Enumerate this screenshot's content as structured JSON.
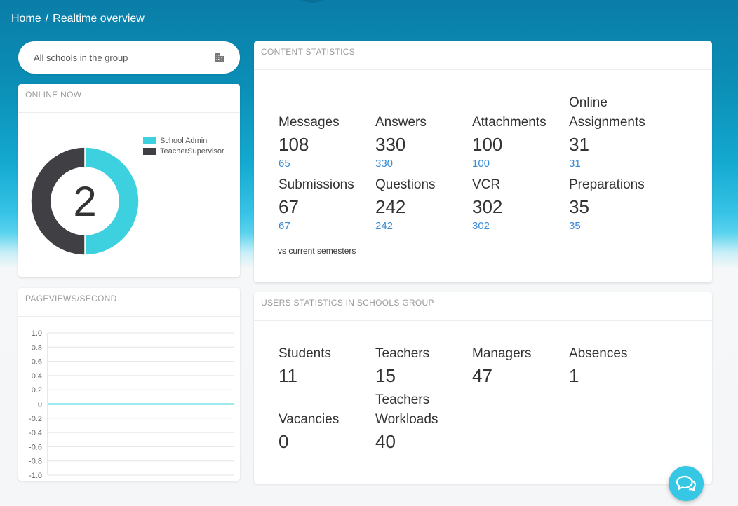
{
  "breadcrumb": {
    "home": "Home",
    "separator": "/",
    "current": "Realtime overview"
  },
  "school_selector": {
    "value": "All schools in the group",
    "icon": "building-icon"
  },
  "online_now": {
    "title": "ONLINE NOW",
    "total": "2",
    "legend": [
      {
        "label": "School Admin",
        "color": "#3dd0de"
      },
      {
        "label": "TeacherSupervisor",
        "color": "#3f3f44"
      }
    ],
    "slices": [
      {
        "label": "School Admin",
        "value": 1,
        "color": "#3dd0de"
      },
      {
        "label": "TeacherSupervisor",
        "value": 1,
        "color": "#3f3f44"
      }
    ]
  },
  "pageviews": {
    "title": "PAGEVIEWS/SECOND",
    "chart_data": {
      "type": "line",
      "title": "",
      "ylim": [
        -1.0,
        1.0
      ],
      "y_ticks": [
        "1.0",
        "0.8",
        "0.6",
        "0.4",
        "0.2",
        "0",
        "-0.2",
        "-0.4",
        "-0.6",
        "-0.8",
        "-1.0"
      ],
      "series": [
        {
          "values": [
            0,
            0
          ]
        }
      ],
      "line_color": "#3dd0de",
      "grid": true
    }
  },
  "content_stats": {
    "title": "CONTENT STATISTICS",
    "items": [
      {
        "label": "Messages",
        "value": "108",
        "sub": "65"
      },
      {
        "label": "Answers",
        "value": "330",
        "sub": "330"
      },
      {
        "label": "Attachments",
        "value": "100",
        "sub": "100"
      },
      {
        "label": "Online Assignments",
        "value": "31",
        "sub": "31"
      },
      {
        "label": "Submissions",
        "value": "67",
        "sub": "67"
      },
      {
        "label": "Questions",
        "value": "242",
        "sub": "242"
      },
      {
        "label": "VCR",
        "value": "302",
        "sub": "302"
      },
      {
        "label": "Preparations",
        "value": "35",
        "sub": "35"
      }
    ],
    "note": "vs current semesters"
  },
  "users_stats": {
    "title": "USERS STATISTICS IN SCHOOLS GROUP",
    "items": [
      {
        "label": "Students",
        "value": "11"
      },
      {
        "label": "Teachers",
        "value": "15"
      },
      {
        "label": "Managers",
        "value": "47"
      },
      {
        "label": "Absences",
        "value": "1"
      },
      {
        "label": "Vacancies",
        "value": "0"
      },
      {
        "label": "Teachers Workloads",
        "value": "40"
      }
    ]
  },
  "chat_button": {
    "icon": "chat-icon"
  }
}
